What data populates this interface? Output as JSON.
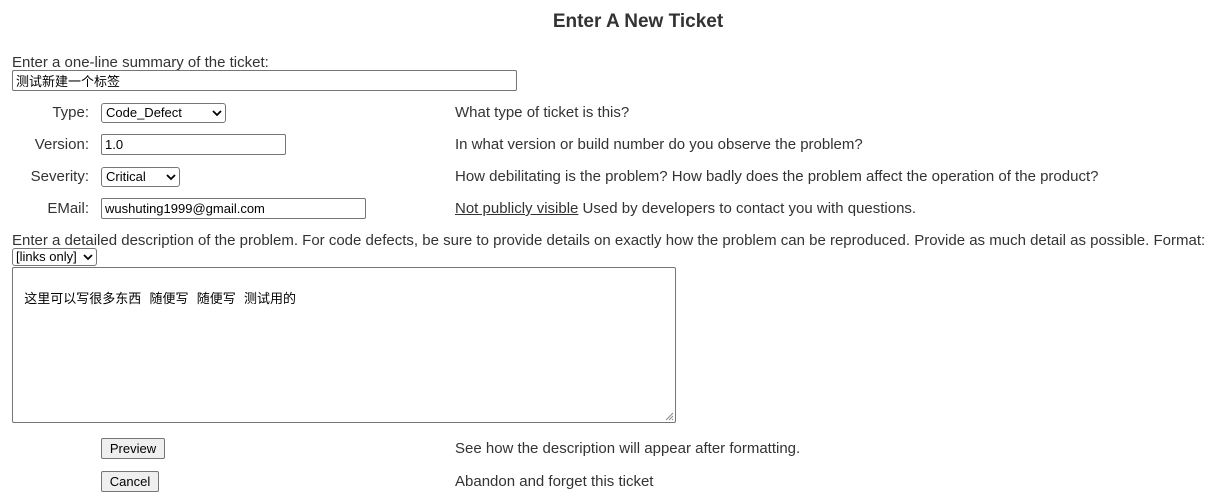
{
  "page": {
    "title": "Enter A New Ticket"
  },
  "summary": {
    "label": "Enter a one-line summary of the ticket:",
    "value": "测试新建一个标签"
  },
  "fields": {
    "type": {
      "label": "Type:",
      "value": "Code_Defect",
      "help": "What type of ticket is this?"
    },
    "version": {
      "label": "Version:",
      "value": "1.0",
      "help": "In what version or build number do you observe the problem?"
    },
    "severity": {
      "label": "Severity:",
      "value": "Critical",
      "help": "How debilitating is the problem? How badly does the problem affect the operation of the product?"
    },
    "email": {
      "label": "EMail:",
      "value": "wushuting1999@gmail.com",
      "help_link": "Not publicly visible",
      "help": " Used by developers to contact you with questions."
    }
  },
  "description": {
    "label": "Enter a detailed description of the problem. For code defects, be sure to provide details on exactly how the problem can be reproduced. Provide as much detail as possible. Format:",
    "format_value": "[links only]",
    "value": "这里可以写很多东西  随便写  随便写  测试用的"
  },
  "actions": {
    "preview_label": "Preview",
    "preview_help": "See how the description will appear after formatting.",
    "cancel_label": "Cancel",
    "cancel_help": "Abandon and forget this ticket"
  },
  "icons": {
    "dropdown": "chevron-down-icon",
    "resize": "resize-grip-icon"
  }
}
